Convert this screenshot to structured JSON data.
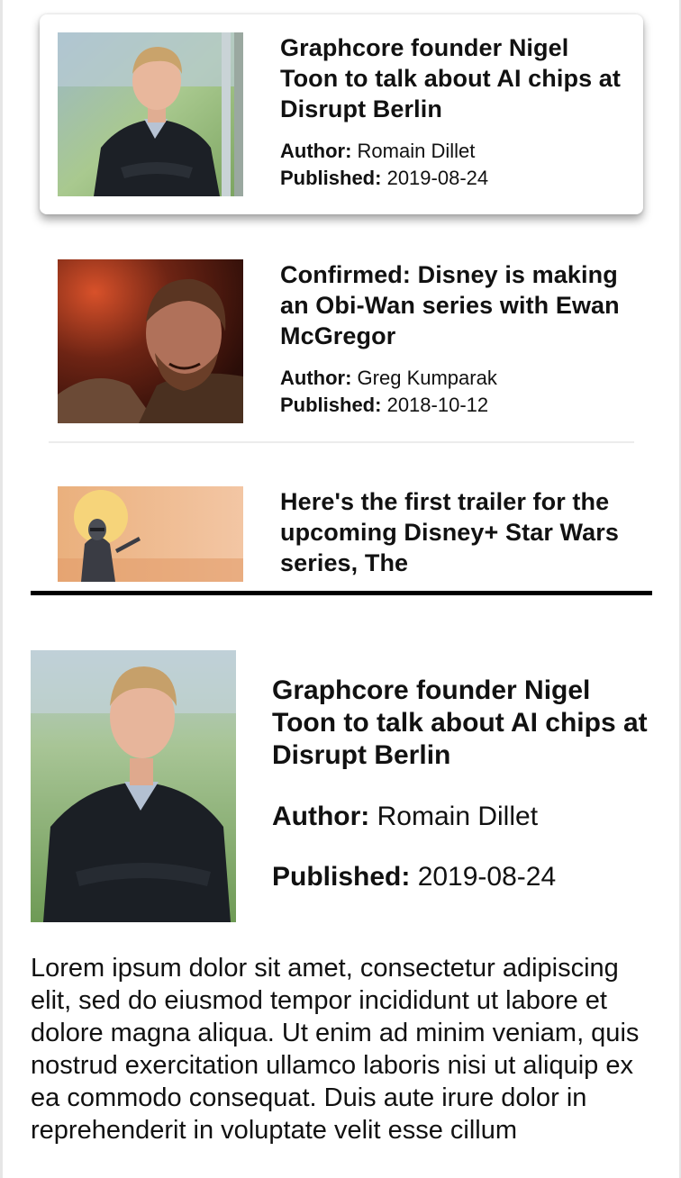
{
  "articles": [
    {
      "title": "Graphcore founder Nigel Toon to talk about AI chips at Disrupt Berlin",
      "author_label": "Author:",
      "author": "Romain Dillet",
      "published_label": "Published:",
      "published": "2019-08-24",
      "image": "portrait-photo",
      "selected": true
    },
    {
      "title": "Confirmed: Disney is making an Obi-Wan series with Ewan McGregor",
      "author_label": "Author:",
      "author": "Greg Kumparak",
      "published_label": "Published:",
      "published": "2018-10-12",
      "image": "obi-wan-photo",
      "selected": false
    },
    {
      "title": "Here's the first trailer for the upcoming Disney+ Star Wars series, The",
      "image": "mandalorian-art",
      "selected": false
    }
  ],
  "detail": {
    "title": "Graphcore founder Nigel Toon to talk about AI chips at Disrupt Berlin",
    "author_label": "Author:",
    "author": "Romain Dillet",
    "published_label": "Published:",
    "published": "2019-08-24",
    "body": "Lorem ipsum dolor sit amet, consectetur adipiscing elit, sed do eiusmod tempor incididunt ut labore et dolore magna aliqua. Ut enim ad minim veniam, quis nostrud exercitation ullamco laboris nisi ut aliquip ex ea commodo consequat. Duis aute irure dolor in reprehenderit in voluptate velit esse cillum"
  },
  "colors": {
    "divider": "#000000",
    "separator": "#ececec",
    "text": "#111111"
  }
}
